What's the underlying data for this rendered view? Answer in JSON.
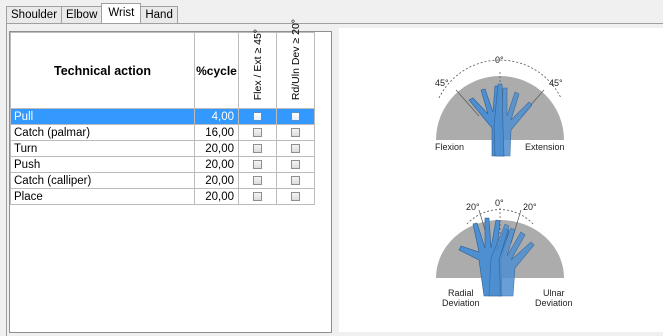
{
  "tabs": [
    {
      "label": "Shoulder",
      "active": false
    },
    {
      "label": "Elbow",
      "active": false
    },
    {
      "label": "Wrist",
      "active": true
    },
    {
      "label": "Hand",
      "active": false
    }
  ],
  "table": {
    "headers": {
      "action": "Technical action",
      "cycle": "%cycle",
      "flex": "Flex / Ext ≥ 45°",
      "dev": "Rd/Uln Dev ≥ 20°"
    },
    "rows": [
      {
        "action": "Pull",
        "cycle": "4,00",
        "flex": false,
        "dev": false,
        "selected": true
      },
      {
        "action": "Catch (palmar)",
        "cycle": "16,00",
        "flex": false,
        "dev": false,
        "selected": false
      },
      {
        "action": "Turn",
        "cycle": "20,00",
        "flex": false,
        "dev": false,
        "selected": false
      },
      {
        "action": "Push",
        "cycle": "20,00",
        "flex": false,
        "dev": false,
        "selected": false
      },
      {
        "action": "Catch (calliper)",
        "cycle": "20,00",
        "flex": false,
        "dev": false,
        "selected": false
      },
      {
        "action": "Place",
        "cycle": "20,00",
        "flex": false,
        "dev": false,
        "selected": false
      }
    ]
  },
  "illustration": {
    "flexion_diagram": {
      "angle_top": "0°",
      "angle_left": "45°",
      "angle_right": "45°",
      "label_left": "Flexion",
      "label_right": "Extension",
      "hand_color": "#4d8fd0",
      "shade_color": "#9d9d9d"
    },
    "deviation_diagram": {
      "angle_top": "0°",
      "angle_left": "20°",
      "angle_right": "20°",
      "label_left_1": "Radial",
      "label_left_2": "Deviation",
      "label_right_1": "Ulnar",
      "label_right_2": "Deviation",
      "hand_color": "#4d8fd0",
      "shade_color": "#9d9d9d"
    }
  }
}
